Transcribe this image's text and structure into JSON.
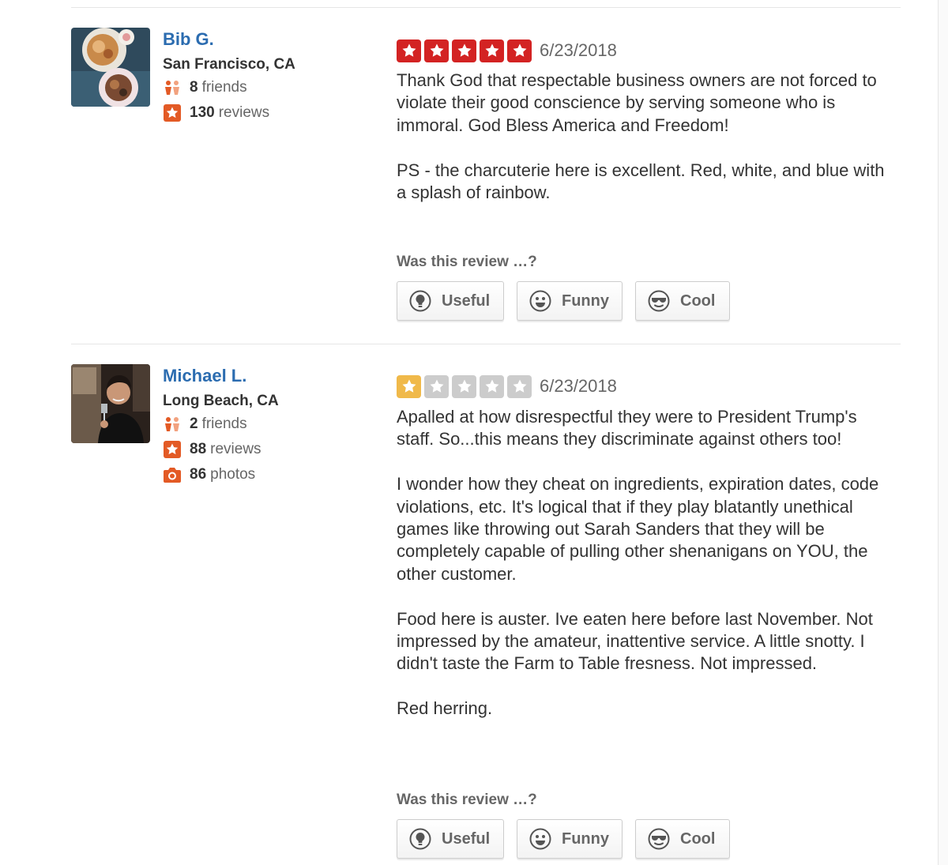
{
  "colors": {
    "link": "#2b6cb0",
    "star_red": "#d32323",
    "star_orange": "#f0b94a",
    "star_empty": "#cccccc",
    "stat_icon": "#e35a25"
  },
  "vote_prompt": "Was this review …?",
  "vote_buttons": [
    {
      "label": "Useful",
      "icon": "lightbulb-icon"
    },
    {
      "label": "Funny",
      "icon": "smiley-icon"
    },
    {
      "label": "Cool",
      "icon": "sunglasses-icon"
    }
  ],
  "reviews": [
    {
      "user": {
        "name": "Bib G.",
        "location": "San Francisco, CA",
        "friends_count": "8",
        "friends_label": "friends",
        "reviews_count": "130",
        "reviews_label": "reviews",
        "avatar": "food-plates-photo"
      },
      "rating": 5,
      "max_rating": 5,
      "date": "6/23/2018",
      "paragraphs": [
        "Thank God that respectable business owners are not forced to violate their good conscience by serving someone who is immoral. God Bless America and Freedom!",
        "PS - the charcuterie here is excellent. Red, white, and blue with a splash of rainbow."
      ]
    },
    {
      "user": {
        "name": "Michael L.",
        "location": "Long Beach, CA",
        "friends_count": "2",
        "friends_label": "friends",
        "reviews_count": "88",
        "reviews_label": "reviews",
        "photos_count": "86",
        "photos_label": "photos",
        "avatar": "man-with-wine-glass-photo"
      },
      "rating": 1,
      "max_rating": 5,
      "date": "6/23/2018",
      "paragraphs": [
        "Apalled at how disrespectful they were to President Trump's staff. So...this means they discriminate against others too!",
        "I wonder how they cheat on ingredients, expiration dates, code violations, etc. It's logical that if they play blatantly unethical games like throwing out Sarah Sanders that they will be completely capable of pulling other shenanigans on YOU, the other customer.",
        "Food here is auster. Ive eaten here before last November. Not impressed by the amateur, inattentive service. A little snotty. I didn't taste the Farm to Table fresness. Not impressed.",
        "Red herring."
      ]
    }
  ]
}
